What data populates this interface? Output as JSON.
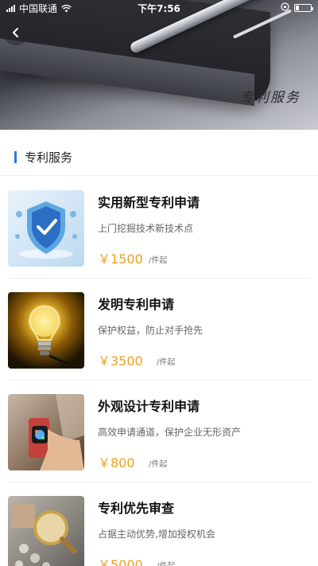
{
  "status_bar": {
    "carrier": "中国联通",
    "time": "下午7:56"
  },
  "hero": {
    "title": "专利服务"
  },
  "section": {
    "title": "专利服务",
    "accent_color": "#2a79e0"
  },
  "services": [
    {
      "name": "实用新型专利申请",
      "desc": "上门挖掘技术新技术点",
      "price": "￥1500",
      "unit": "/件起",
      "image_icon": "shield-check-icon"
    },
    {
      "name": "发明专利申请",
      "desc": "保护权益，防止对手抢先",
      "price": "￥3500",
      "unit": "/件起",
      "image_icon": "lightbulb-icon"
    },
    {
      "name": "外观设计专利申请",
      "desc": "高效申请通道，保护企业无形资产",
      "price": "￥800",
      "unit": "/件起",
      "image_icon": "smartwatch-icon"
    },
    {
      "name": "专利优先审查",
      "desc": "占据主动优势,增加授权机会",
      "price": "￥5000",
      "unit": "/件起",
      "image_icon": "magnifier-icon"
    }
  ],
  "price_color": "#f0a020"
}
